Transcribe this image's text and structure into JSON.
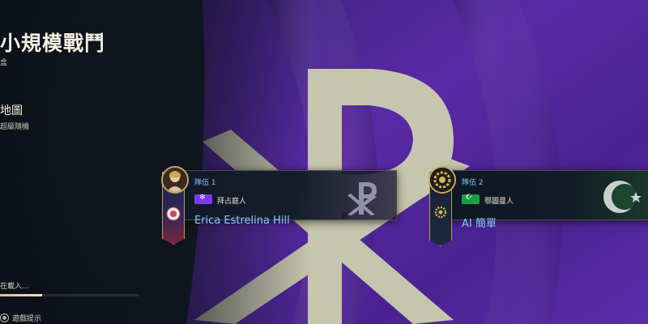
{
  "header": {
    "title": "小規模戰鬥",
    "subtitle": "盒"
  },
  "map": {
    "label": "地圖",
    "value": "超級隨機"
  },
  "loading": {
    "text": "在載入...",
    "progress": 0.3
  },
  "footer": {
    "tips_label": "遊戲提示"
  },
  "teams": [
    {
      "team_label": "隊伍 1",
      "civ_name": "拜占庭人",
      "player_name": "Erica Estrelina Hill",
      "flag_color": "#7c3aed",
      "emblem": "chi-rho-icon"
    },
    {
      "team_label": "隊伍 2",
      "civ_name": "鄂圖曼人",
      "player_name": "AI 簡單",
      "flag_color": "#1f9d45",
      "emblem": "crescent-star-icon"
    }
  ],
  "colors": {
    "background_flag": "#5a2aa6",
    "emblem": "#d8dcb2",
    "accent": "#c7a85a"
  }
}
